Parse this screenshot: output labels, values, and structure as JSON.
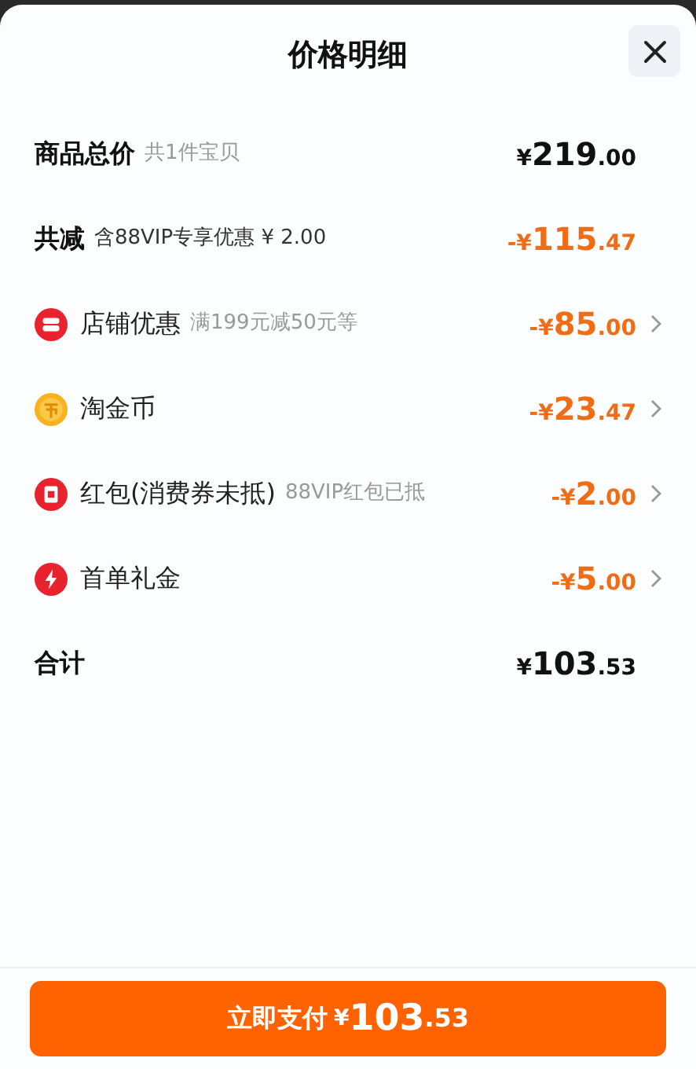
{
  "title": "价格明细",
  "rows": [
    {
      "kind": "total",
      "label": "商品总价",
      "note": "共1件宝贝",
      "amount": {
        "symbol": "¥",
        "whole": "219",
        "fraction": ".00"
      }
    },
    {
      "kind": "reduction",
      "label": "共减",
      "note": "含88VIP专享优惠 ¥ 2.00",
      "amount": {
        "symbol": "-¥",
        "whole": "115",
        "fraction": ".47"
      }
    },
    {
      "kind": "shop",
      "label": "店铺优惠",
      "note": "满199元减50元等",
      "amount": {
        "symbol": "-¥",
        "whole": "85",
        "fraction": ".00"
      }
    },
    {
      "kind": "coin",
      "label": "淘金币",
      "amount": {
        "symbol": "-¥",
        "whole": "23",
        "fraction": ".47"
      }
    },
    {
      "kind": "red-packet",
      "label": "红包(消费券未抵)",
      "note": "88VIP红包已抵",
      "amount": {
        "symbol": "-¥",
        "whole": "2",
        "fraction": ".00"
      }
    },
    {
      "kind": "gift",
      "label": "首单礼金",
      "amount": {
        "symbol": "-¥",
        "whole": "5",
        "fraction": ".00"
      }
    },
    {
      "kind": "total",
      "label": "合计",
      "amount": {
        "symbol": "¥",
        "whole": "103",
        "fraction": ".53"
      }
    }
  ],
  "pay_button": {
    "label": "立即支付",
    "amount": {
      "symbol": "¥",
      "whole": "103",
      "fraction": ".53"
    }
  }
}
